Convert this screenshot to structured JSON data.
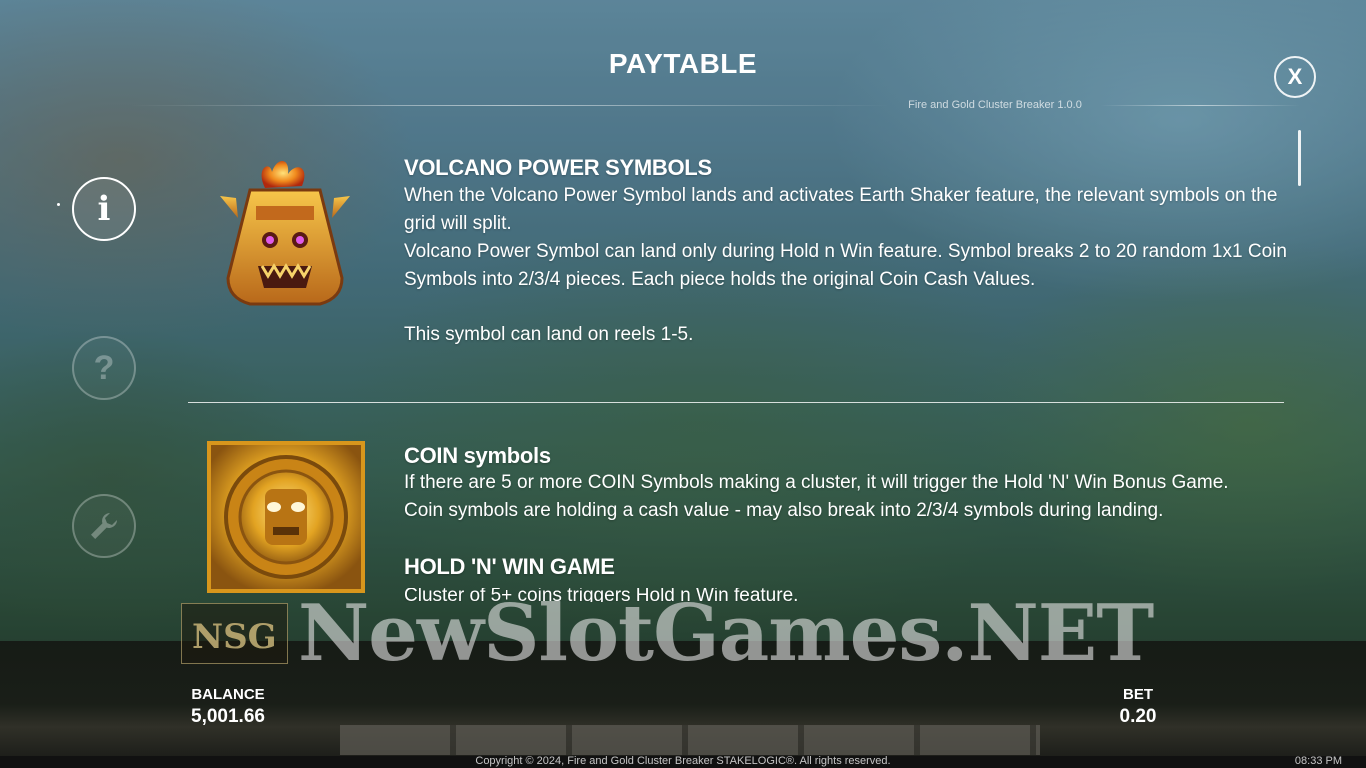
{
  "header": {
    "title": "PAYTABLE",
    "version": "Fire and Gold Cluster Breaker 1.0.0",
    "close_label": "X"
  },
  "nav": {
    "info_glyph": "i",
    "help_glyph": "?",
    "settings_icon": "wrench-icon"
  },
  "sections": {
    "volcano": {
      "title": "VOLCANO POWER SYMBOLS",
      "line1": "When the Volcano Power Symbol lands and activates Earth Shaker feature, the relevant symbols on the grid will split.",
      "line2": "Volcano Power Symbol can land only during Hold n Win feature. Symbol breaks 2 to 20 random 1x1 Coin Symbols into 2/3/4 pieces. Each piece holds the original Coin Cash Values.",
      "line3": "This symbol can land on reels 1-5."
    },
    "coin": {
      "title": "COIN symbols",
      "line1": "If there are 5 or more COIN Symbols making a cluster, it will trigger the Hold 'N' Win Bonus Game.",
      "line2": "Coin symbols are holding a cash value - may also break into 2/3/4 symbols during landing."
    },
    "hold": {
      "title": "HOLD 'N' WIN GAME",
      "line1": "Cluster of 5+ coins triggers Hold n Win feature."
    }
  },
  "watermark": {
    "text": "NewSlotGames.NET",
    "logo_letters": "NSG"
  },
  "bottom": {
    "balance_label": "BALANCE",
    "balance_value": "5,001.66",
    "bet_label": "BET",
    "bet_value": "0.20"
  },
  "footer": {
    "copyright": "Copyright © 2024, Fire and Gold Cluster Breaker STAKELOGIC®. All rights reserved.",
    "clock": "08:33 PM"
  },
  "colors": {
    "accent_gold": "#f2b51f",
    "fire_orange": "#e8661a"
  }
}
